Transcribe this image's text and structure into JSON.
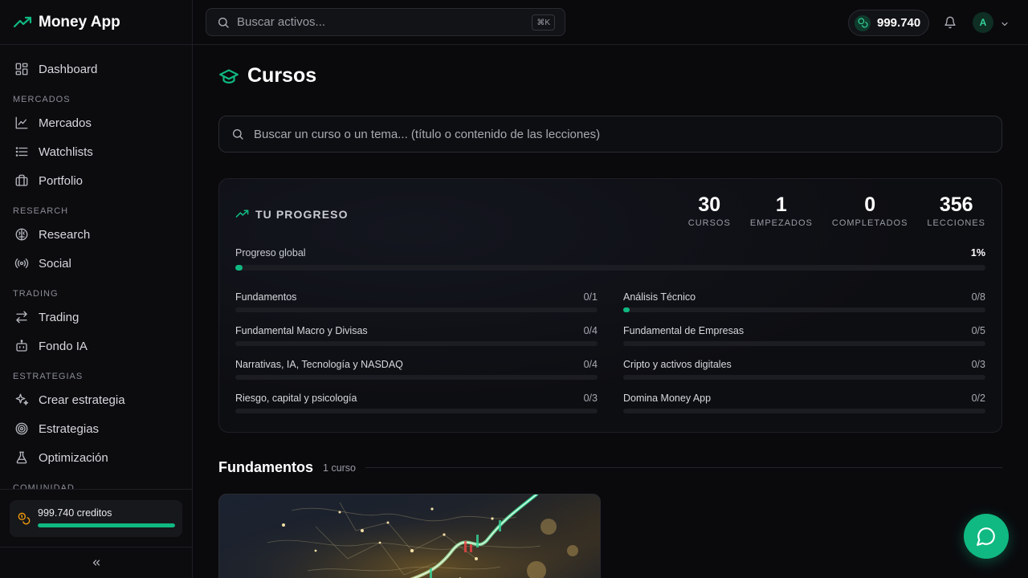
{
  "app": {
    "name": "Money App"
  },
  "sidebar": {
    "items": [
      {
        "label": "Dashboard",
        "icon": "dashboard-icon"
      },
      {
        "section": "MERCADOS"
      },
      {
        "label": "Mercados",
        "icon": "chart-line-icon"
      },
      {
        "label": "Watchlists",
        "icon": "list-icon"
      },
      {
        "label": "Portfolio",
        "icon": "briefcase-icon"
      },
      {
        "section": "RESEARCH"
      },
      {
        "label": "Research",
        "icon": "brain-icon"
      },
      {
        "label": "Social",
        "icon": "broadcast-icon"
      },
      {
        "section": "TRADING"
      },
      {
        "label": "Trading",
        "icon": "swap-icon"
      },
      {
        "label": "Fondo IA",
        "icon": "robot-icon"
      },
      {
        "section": "ESTRATEGIAS"
      },
      {
        "label": "Crear estrategia",
        "icon": "sparkles-icon"
      },
      {
        "label": "Estrategias",
        "icon": "target-icon"
      },
      {
        "label": "Optimización",
        "icon": "flask-icon"
      },
      {
        "section": "COMUNIDAD"
      }
    ],
    "credits": {
      "label": "999.740 creditos",
      "level": 0.999
    }
  },
  "topbar": {
    "search_placeholder": "Buscar activos...",
    "shortcut": "⌘K",
    "balance": "999.740",
    "avatar_initial": "A"
  },
  "page": {
    "title": "Cursos",
    "search_placeholder": "Buscar un curso o un tema... (título o contenido de las lecciones)"
  },
  "progress": {
    "heading": "TU PROGRESO",
    "stats": [
      {
        "value": "30",
        "label": "CURSOS"
      },
      {
        "value": "1",
        "label": "EMPEZADOS"
      },
      {
        "value": "0",
        "label": "COMPLETADOS"
      },
      {
        "value": "356",
        "label": "LECCIONES"
      }
    ],
    "global": {
      "label": "Progreso global",
      "percent_text": "1%",
      "level": 0.01
    },
    "categories": [
      {
        "name": "Fundamentos",
        "count": "0/1",
        "level": 0
      },
      {
        "name": "Análisis Técnico",
        "count": "0/8",
        "level": 0.01
      },
      {
        "name": "Fundamental Macro y Divisas",
        "count": "0/4",
        "level": 0
      },
      {
        "name": "Fundamental de Empresas",
        "count": "0/5",
        "level": 0
      },
      {
        "name": "Narrativas, IA, Tecnología y NASDAQ",
        "count": "0/4",
        "level": 0
      },
      {
        "name": "Cripto y activos digitales",
        "count": "0/3",
        "level": 0
      },
      {
        "name": "Riesgo, capital y psicología",
        "count": "0/3",
        "level": 0
      },
      {
        "name": "Domina Money App",
        "count": "0/2",
        "level": 0
      }
    ]
  },
  "section": {
    "title": "Fundamentos",
    "count": "1 curso"
  },
  "colors": {
    "accent": "#10b981",
    "background": "#0a0a0d",
    "credits_icon": "#f59e0b"
  }
}
